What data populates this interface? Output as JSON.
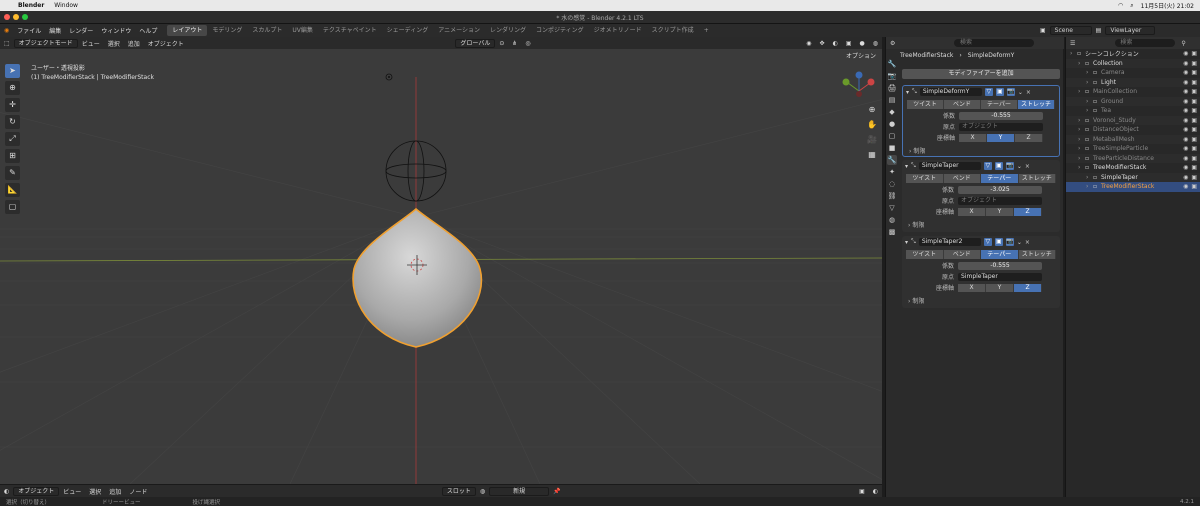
{
  "mac_menu": {
    "app": "Blender",
    "items": [
      "Window"
    ],
    "clock": "11月5日(火) 21:02"
  },
  "window_title": "* 水の感覚 - Blender 4.2.1 LTS",
  "top_menu": [
    "ファイル",
    "編集",
    "レンダー",
    "ウィンドウ",
    "ヘルプ"
  ],
  "workspaces": [
    {
      "label": "レイアウト",
      "active": true
    },
    {
      "label": "モデリング",
      "active": false
    },
    {
      "label": "スカルプト",
      "active": false
    },
    {
      "label": "UV編集",
      "active": false
    },
    {
      "label": "テクスチャペイント",
      "active": false
    },
    {
      "label": "シェーディング",
      "active": false
    },
    {
      "label": "アニメーション",
      "active": false
    },
    {
      "label": "レンダリング",
      "active": false
    },
    {
      "label": "コンポジティング",
      "active": false
    },
    {
      "label": "ジオメトリノード",
      "active": false
    },
    {
      "label": "スクリプト作成",
      "active": false
    }
  ],
  "scene": {
    "name": "Scene",
    "view_layer": "ViewLayer"
  },
  "viewport_header": {
    "mode": "オブジェクトモード",
    "menus": [
      "ビュー",
      "選択",
      "追加",
      "オブジェクト"
    ],
    "transform": "グローバル",
    "options": "オプション"
  },
  "viewport_info": {
    "line1": "ユーザー・透視投影",
    "line2": "(1) TreeModifierStack | TreeModifierStack"
  },
  "bottom_bar": {
    "mode": "オブジェクト",
    "menus": [
      "ビュー",
      "選択",
      "追加",
      "ノード"
    ],
    "slot": "スロット",
    "new_label": "新規"
  },
  "status_bar": {
    "items": [
      "選択（切り替え）",
      "ドリーービュー",
      "投げ縄選択"
    ],
    "version": "4.2.1"
  },
  "properties": {
    "search": "検索",
    "breadcrumb_object": "TreeModifierStack",
    "breadcrumb_modifier": "SimpleDeformY",
    "add_modifier": "モディファイアーを追加",
    "modifiers": [
      {
        "name": "SimpleDeformY",
        "modes": [
          "ツイスト",
          "ベンド",
          "テーパー",
          "ストレッチ"
        ],
        "active_mode": 3,
        "factor_label": "係数",
        "factor": "-0.555",
        "origin_label": "原点",
        "origin": "オブジェクト",
        "axis_label": "座標軸",
        "axes": [
          "X",
          "Y",
          "Z"
        ],
        "active_axis": 1,
        "restrict": "制限"
      },
      {
        "name": "SimpleTaper",
        "modes": [
          "ツイスト",
          "ベンド",
          "テーパー",
          "ストレッチ"
        ],
        "active_mode": 2,
        "factor_label": "係数",
        "factor": "-3.025",
        "origin_label": "原点",
        "origin": "オブジェクト",
        "axis_label": "座標軸",
        "axes": [
          "X",
          "Y",
          "Z"
        ],
        "active_axis": 2,
        "restrict": "制限"
      },
      {
        "name": "SimpleTaper2",
        "modes": [
          "ツイスト",
          "ベンド",
          "テーパー",
          "ストレッチ"
        ],
        "active_mode": 2,
        "factor_label": "係数",
        "factor": "-0.555",
        "origin_label": "原点",
        "origin": "SimpleTaper",
        "axis_label": "座標軸",
        "axes": [
          "X",
          "Y",
          "Z"
        ],
        "active_axis": 2,
        "restrict": "制限"
      }
    ]
  },
  "outliner": {
    "search": "検索",
    "rows": [
      {
        "name": "シーンコレクション",
        "indent": 0,
        "dim": false,
        "selected": false
      },
      {
        "name": "Collection",
        "indent": 1,
        "dim": false,
        "selected": false
      },
      {
        "name": "Camera",
        "indent": 2,
        "dim": true,
        "selected": false
      },
      {
        "name": "Light",
        "indent": 2,
        "dim": false,
        "selected": false
      },
      {
        "name": "MainCollection",
        "indent": 1,
        "dim": true,
        "selected": false
      },
      {
        "name": "Ground",
        "indent": 2,
        "dim": true,
        "selected": false
      },
      {
        "name": "Tea",
        "indent": 2,
        "dim": true,
        "selected": false
      },
      {
        "name": "Voronoi_Study",
        "indent": 1,
        "dim": true,
        "selected": false
      },
      {
        "name": "DistanceObject",
        "indent": 1,
        "dim": true,
        "selected": false
      },
      {
        "name": "MetaballMesh",
        "indent": 1,
        "dim": true,
        "selected": false
      },
      {
        "name": "TreeSimpleParticle",
        "indent": 1,
        "dim": true,
        "selected": false
      },
      {
        "name": "TreeParticleDistance",
        "indent": 1,
        "dim": true,
        "selected": false
      },
      {
        "name": "TreeModifierStack",
        "indent": 1,
        "dim": false,
        "selected": false
      },
      {
        "name": "SimpleTaper",
        "indent": 2,
        "dim": false,
        "selected": false
      },
      {
        "name": "TreeModifierStack",
        "indent": 2,
        "dim": false,
        "selected": true
      }
    ]
  }
}
